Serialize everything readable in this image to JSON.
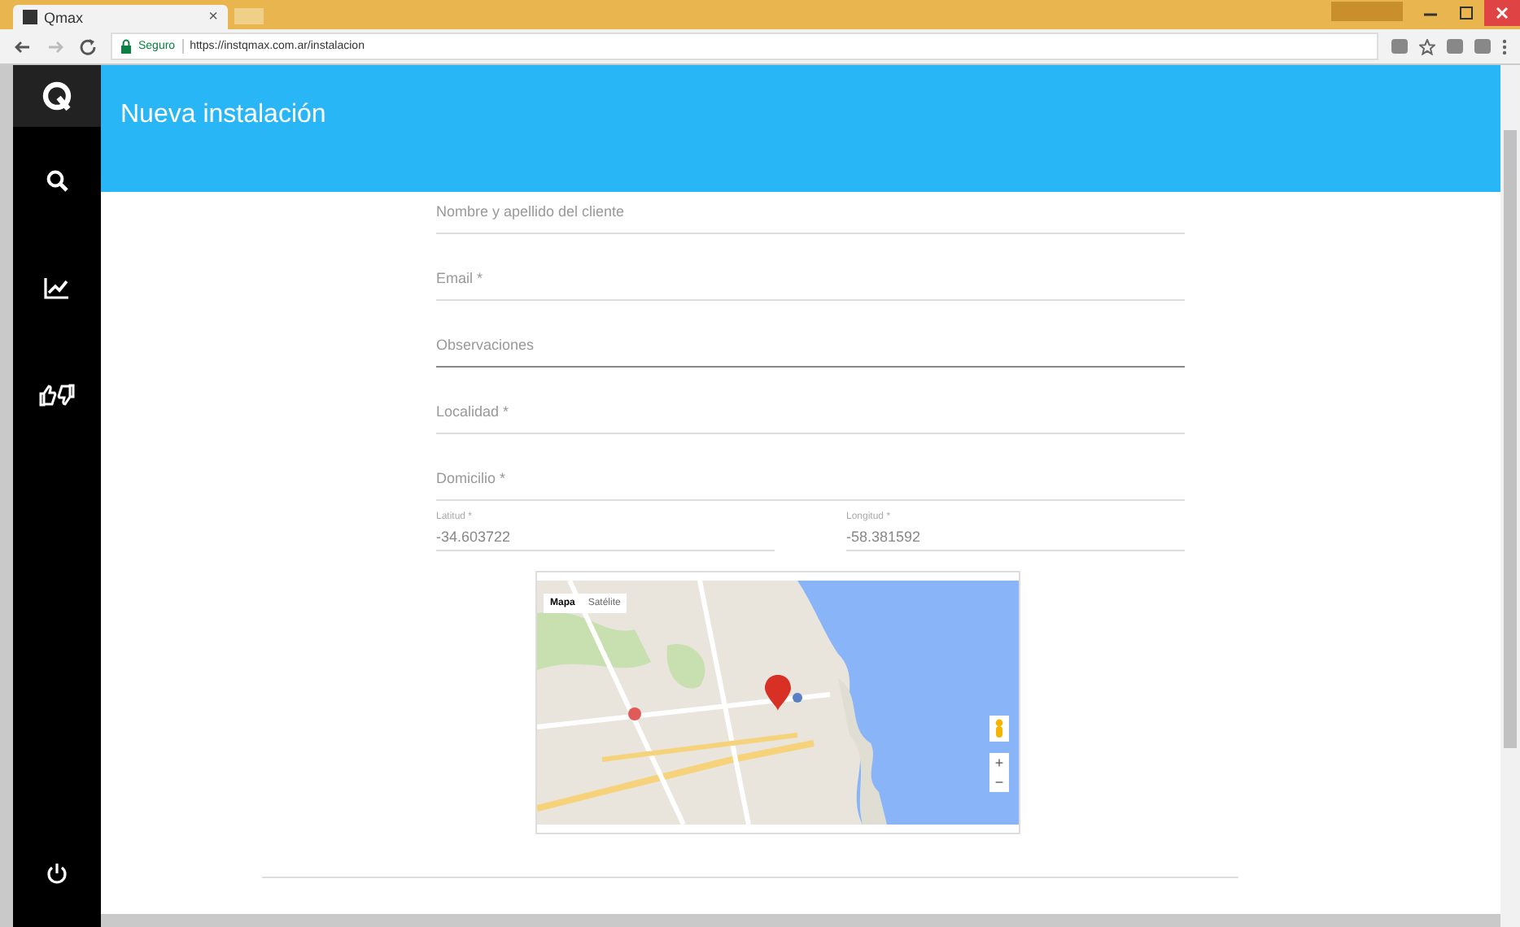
{
  "browser": {
    "tab_title": "Qmax",
    "tab_close": "×",
    "secure_label": "Seguro",
    "url": "https://instqmax.com.ar/instalacion"
  },
  "sidebar": {
    "items": [
      {
        "selected": false
      },
      {
        "selected": false
      },
      {
        "selected": false
      }
    ]
  },
  "header": {
    "title": "Nueva instalación"
  },
  "form": {
    "fields": [
      {
        "placeholder": "Nombre y apellido del cliente",
        "focused": false
      },
      {
        "placeholder": "Email *",
        "focused": false
      },
      {
        "placeholder": "Observaciones",
        "focused": true
      },
      {
        "placeholder": "Localidad *",
        "focused": false
      },
      {
        "placeholder": "Domicilio *",
        "focused": false
      }
    ],
    "coords": [
      {
        "label": "Latitud *",
        "value": "-34.603722"
      },
      {
        "label": "Longitud *",
        "value": "-58.381592"
      }
    ]
  },
  "map": {
    "types": [
      {
        "label": "Mapa",
        "selected": true
      },
      {
        "label": "Satélite",
        "selected": false
      }
    ],
    "zoom_in": "+",
    "zoom_out": "−"
  }
}
